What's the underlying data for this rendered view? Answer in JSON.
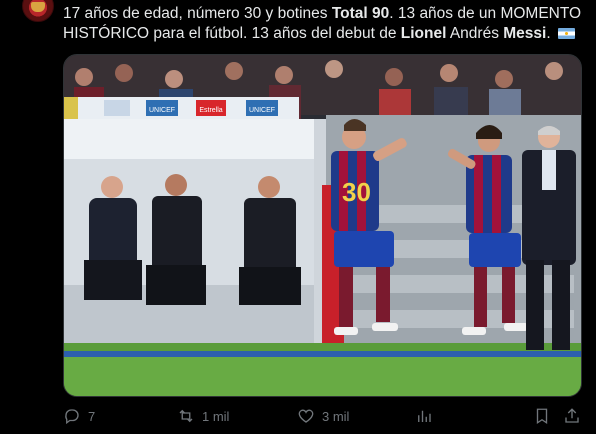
{
  "tweet": {
    "segments": [
      {
        "text": "17 años de edad, número 30 y botines ",
        "bold": false
      },
      {
        "text": "Total 90",
        "bold": true
      },
      {
        "text": ". 13 años de un MOMENTO HISTÓRICO para el fútbol. 13 años del debut de ",
        "bold": false
      },
      {
        "text": "Lionel",
        "bold": true
      },
      {
        "text": " Andrés ",
        "bold": false
      },
      {
        "text": "Messi",
        "bold": true
      },
      {
        "text": ".",
        "bold": false
      }
    ],
    "flag_icon": "argentina-flag-emoji"
  },
  "photo": {
    "ad_boards": [
      "UNICEF",
      "Estrella",
      "UNICEF"
    ],
    "player_number": "30",
    "colors": {
      "blaugrana_blue": "#1f3a8a",
      "blaugrana_red": "#a3123a",
      "pitch": "#5a9c3a",
      "sky_crowd": "#2b2e36"
    }
  },
  "actions": {
    "reply": {
      "icon": "reply-icon",
      "count": "7"
    },
    "retweet": {
      "icon": "retweet-icon",
      "count": "1 mil"
    },
    "like": {
      "icon": "heart-icon",
      "count": "3 mil"
    },
    "views": {
      "icon": "views-icon",
      "count": ""
    },
    "bookmark": {
      "icon": "bookmark-icon"
    },
    "share": {
      "icon": "share-icon"
    }
  }
}
